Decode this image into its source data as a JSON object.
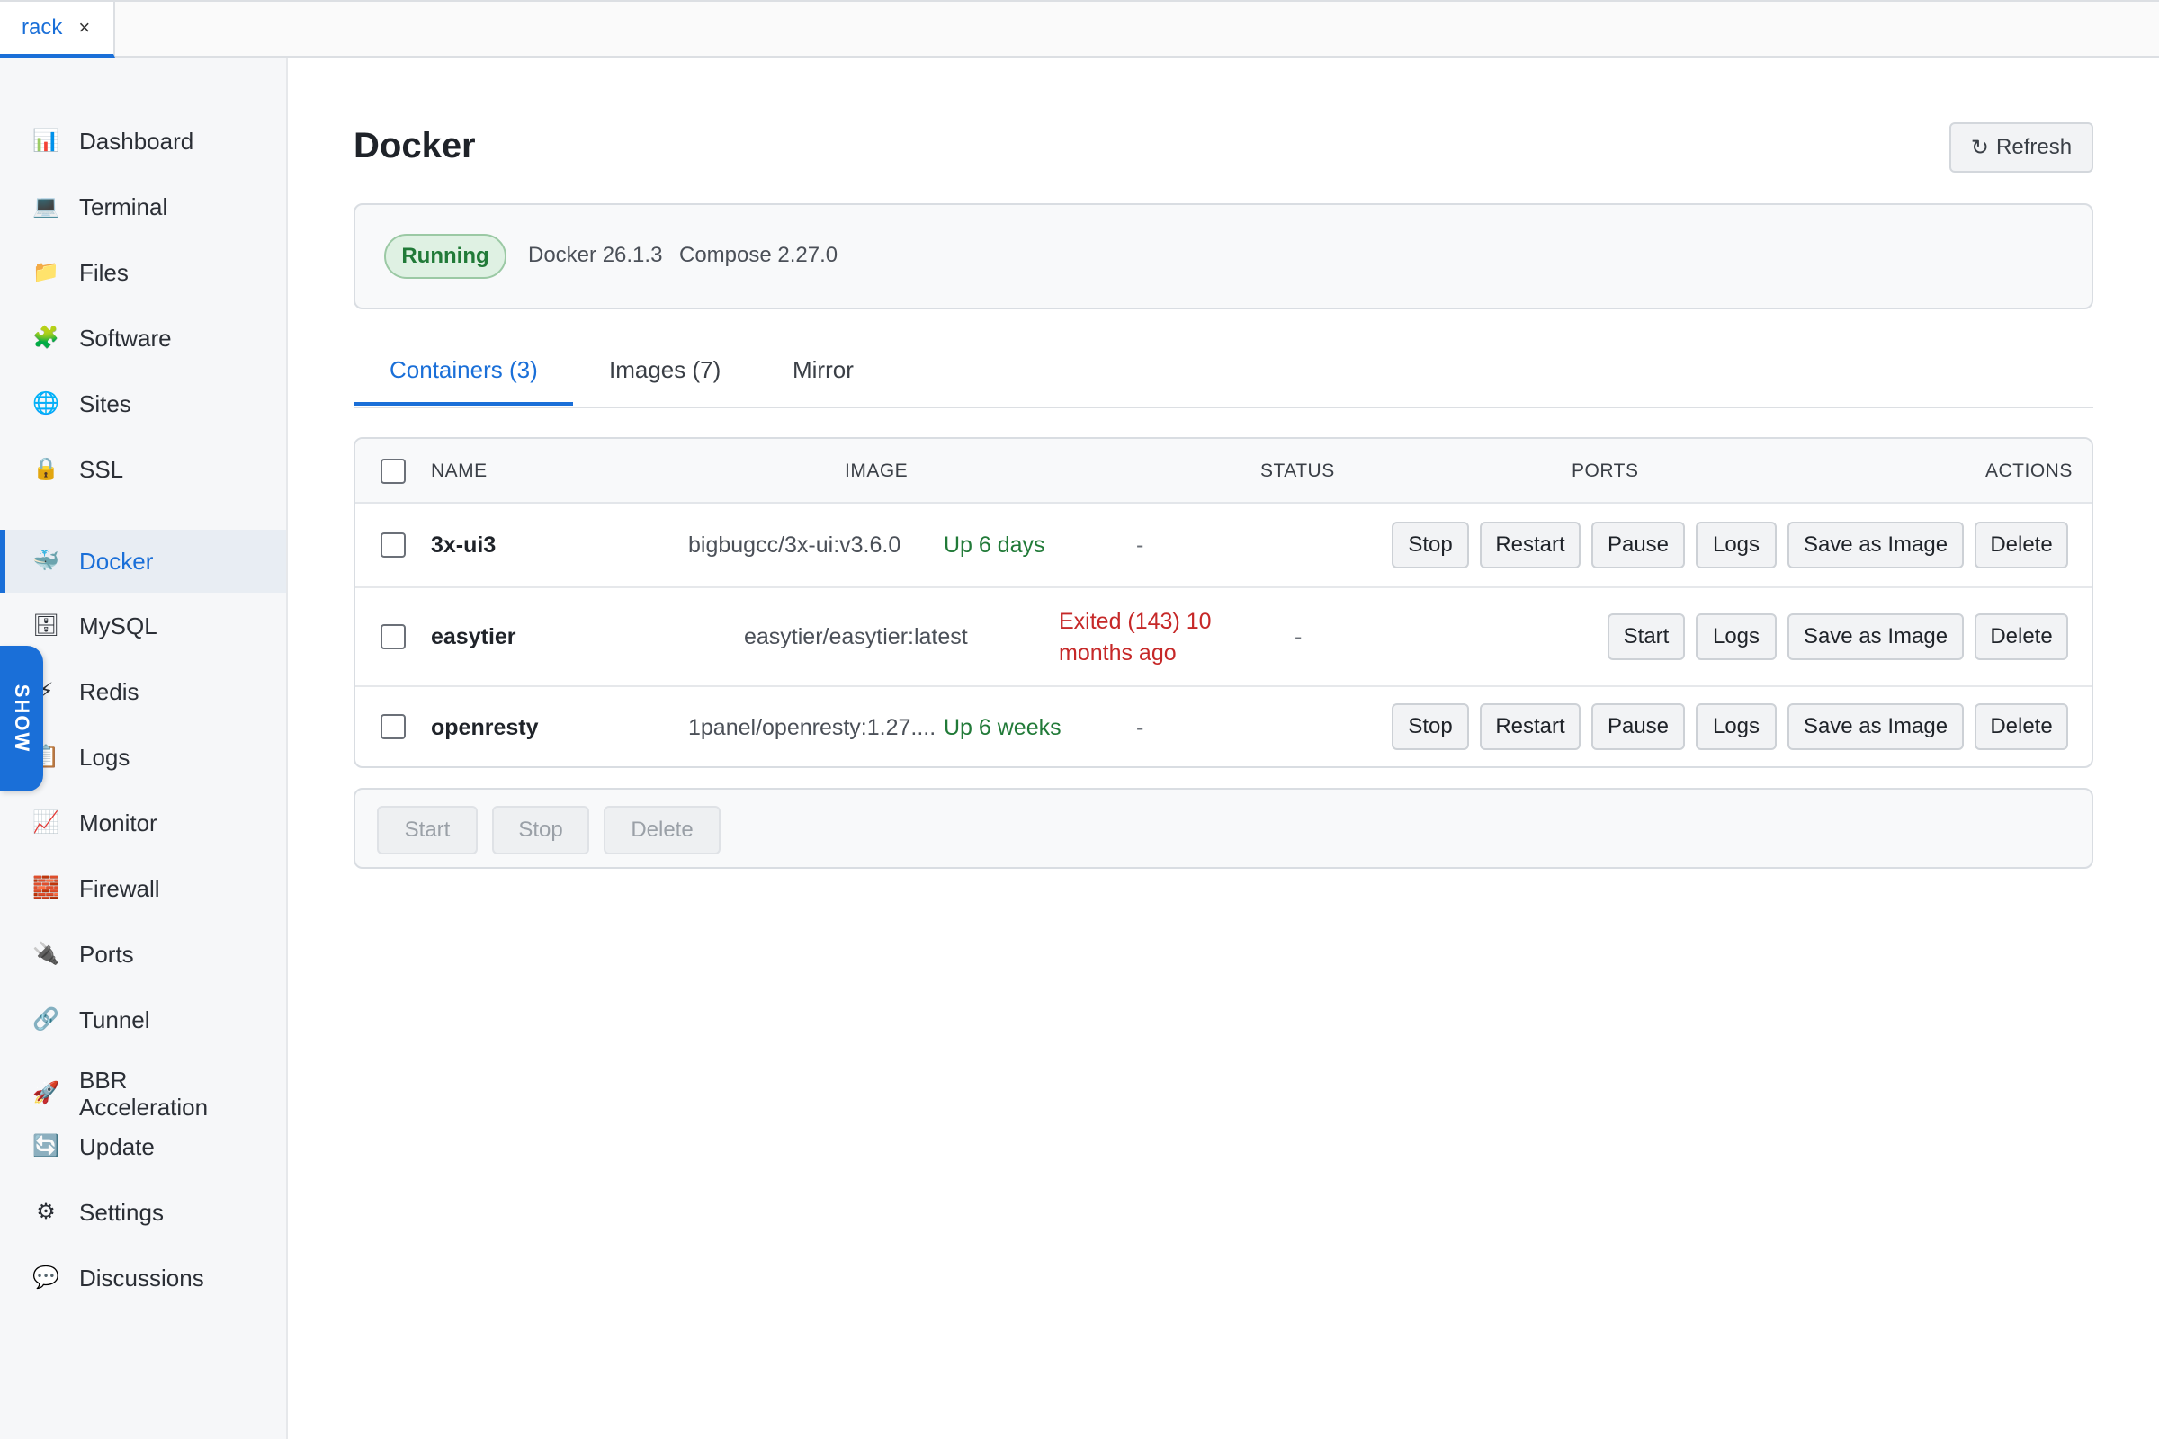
{
  "window_tab": {
    "label": "rack",
    "close": "×"
  },
  "sidebar": {
    "items": [
      {
        "label": "Dashboard",
        "icon": "bar-chart-icon",
        "glyph": "📊"
      },
      {
        "label": "Terminal",
        "icon": "computer-icon",
        "glyph": "💻"
      },
      {
        "label": "Files",
        "icon": "folder-icon",
        "glyph": "📁"
      },
      {
        "label": "Software",
        "icon": "puzzle-icon",
        "glyph": "🧩"
      },
      {
        "label": "Sites",
        "icon": "globe-icon",
        "glyph": "🌐"
      },
      {
        "label": "SSL",
        "icon": "lock-icon",
        "glyph": "🔒"
      },
      {
        "label": "Docker",
        "icon": "whale-icon",
        "glyph": "🐳"
      },
      {
        "label": "MySQL",
        "icon": "database-icon",
        "glyph": "🗄"
      },
      {
        "label": "Redis",
        "icon": "lightning-icon",
        "glyph": "⚡"
      },
      {
        "label": "Logs",
        "icon": "clipboard-icon",
        "glyph": "📋"
      },
      {
        "label": "Monitor",
        "icon": "chart-icon",
        "glyph": "📈"
      },
      {
        "label": "Firewall",
        "icon": "brick-icon",
        "glyph": "🧱"
      },
      {
        "label": "Ports",
        "icon": "plug-icon",
        "glyph": "🔌"
      },
      {
        "label": "Tunnel",
        "icon": "link-icon",
        "glyph": "🔗"
      },
      {
        "label": "BBR Acceleration",
        "line1": "BBR",
        "line2": "Acceleration",
        "icon": "rocket-icon",
        "glyph": "🚀"
      },
      {
        "label": "Update",
        "icon": "refresh-icon",
        "glyph": "🔄"
      },
      {
        "label": "Settings",
        "icon": "gear-icon",
        "glyph": "⚙"
      },
      {
        "label": "Discussions",
        "icon": "speech-bubble-icon",
        "glyph": "💬"
      }
    ],
    "active": "Docker"
  },
  "show_tab": {
    "label": "SHOW"
  },
  "main": {
    "title": "Docker",
    "refresh_label": "Refresh",
    "refresh_glyph": "↻",
    "status": {
      "badge": "Running",
      "docker_version": "Docker 26.1.3",
      "compose_version": "Compose 2.27.0"
    },
    "tabs": [
      {
        "label": "Containers (3)"
      },
      {
        "label": "Images (7)"
      },
      {
        "label": "Mirror"
      }
    ],
    "active_tab": "Containers (3)",
    "table": {
      "headers": [
        "NAME",
        "IMAGE",
        "STATUS",
        "PORTS",
        "ACTIONS"
      ],
      "rows": [
        {
          "name": "3x-ui3",
          "image": "bigbugcc/3x-ui:v3.6.0",
          "status": "Up 6 days",
          "status_kind": "up",
          "ports": "-",
          "actions": [
            "Stop",
            "Restart",
            "Pause",
            "Logs",
            "Save as Image",
            "Delete"
          ]
        },
        {
          "name": "easytier",
          "image": "easytier/easytier:latest",
          "status": "Exited (143) 10 months ago",
          "status_line1": "Exited (143) 10",
          "status_line2": "months ago",
          "status_kind": "exited",
          "ports": "-",
          "actions": [
            "Start",
            "Logs",
            "Save as Image",
            "Delete"
          ]
        },
        {
          "name": "openresty",
          "image": "1panel/openresty:1.27....",
          "status": "Up 6 weeks",
          "status_kind": "up",
          "ports": "-",
          "actions": [
            "Stop",
            "Restart",
            "Pause",
            "Logs",
            "Save as Image",
            "Delete"
          ]
        }
      ]
    },
    "bulk_actions": [
      "Start",
      "Stop",
      "Delete"
    ]
  },
  "colors": {
    "accent": "#1a6fd8",
    "running_green": "#217a38",
    "exited_red": "#c62828"
  }
}
